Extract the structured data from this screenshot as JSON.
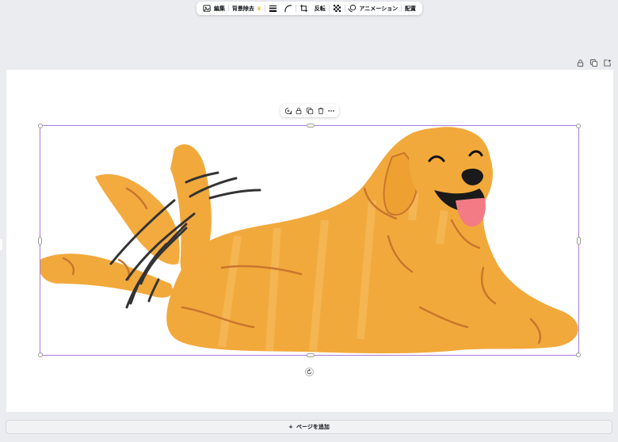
{
  "toolbar": {
    "edit_label": "編集",
    "remove_bg_label": "背景除去",
    "flip_label": "反転",
    "animation_label": "アニメーション",
    "position_label": "配置"
  },
  "footer": {
    "add_page_plus": "+",
    "add_page_label": "ページを追加"
  },
  "colors": {
    "selection": "#a67bd9",
    "dog_fur": "#f2a93b",
    "dog_outline": "#c9762e",
    "tongue": "#f27b86",
    "crown": "#f2b21b"
  }
}
